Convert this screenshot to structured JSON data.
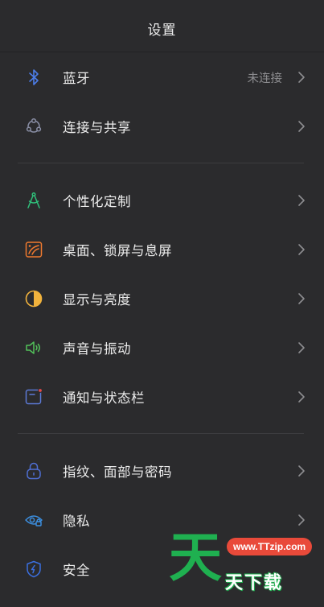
{
  "header": {
    "title": "设置"
  },
  "groups": [
    {
      "items": [
        {
          "label": "蓝牙",
          "value": "未连接",
          "icon": "bluetooth-icon",
          "icon_color": "#4c7de8"
        },
        {
          "label": "连接与共享",
          "icon": "share-network-icon",
          "icon_color": "#8a8fa6"
        }
      ]
    },
    {
      "items": [
        {
          "label": "个性化定制",
          "icon": "compass-pen-icon",
          "icon_color": "#2fbf7a"
        },
        {
          "label": "桌面、锁屏与息屏",
          "icon": "wallpaper-icon",
          "icon_color": "#f07a2f"
        },
        {
          "label": "显示与亮度",
          "icon": "contrast-icon",
          "icon_color": "#f2b33d"
        },
        {
          "label": "声音与振动",
          "icon": "speaker-icon",
          "icon_color": "#52c15a"
        },
        {
          "label": "通知与状态栏",
          "icon": "notification-icon",
          "icon_color": "#5c7ad6"
        }
      ]
    },
    {
      "items": [
        {
          "label": "指纹、面部与密码",
          "icon": "lock-icon",
          "icon_color": "#4f6fd4"
        },
        {
          "label": "隐私",
          "icon": "privacy-eye-icon",
          "icon_color": "#3c8fe0"
        },
        {
          "label": "安全",
          "icon": "shield-icon",
          "icon_color": "#3b6fe0"
        }
      ]
    }
  ],
  "watermark": {
    "big_char": "天",
    "url": "www.TTzip.com",
    "text": "天下载"
  }
}
